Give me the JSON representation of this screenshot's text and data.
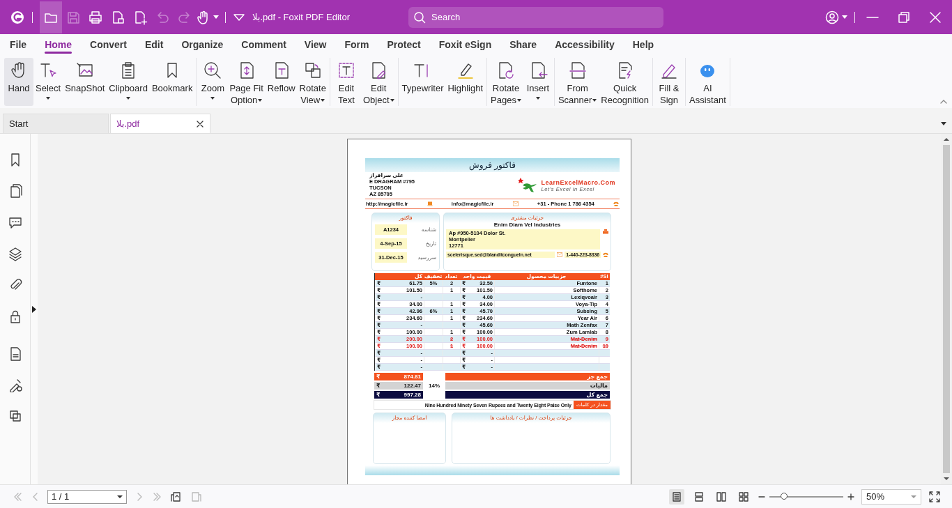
{
  "titlebar": {
    "title": "بلا.pdf - Foxit PDF Editor",
    "search": {
      "placeholder": "Search"
    }
  },
  "quick_access": [
    {
      "highlighted": true,
      "disabled": false
    },
    {
      "highlighted": false,
      "disabled": true
    },
    {
      "highlighted": false,
      "disabled": false
    },
    {
      "highlighted": false,
      "disabled": false
    },
    {
      "highlighted": false,
      "disabled": false
    },
    {
      "highlighted": false,
      "disabled": true
    },
    {
      "highlighted": false,
      "disabled": true
    },
    {
      "highlighted": false,
      "disabled": false
    }
  ],
  "menu": [
    {
      "label": "File",
      "selected": false
    },
    {
      "label": "Home",
      "selected": true
    },
    {
      "label": "Convert",
      "selected": false
    },
    {
      "label": "Edit",
      "selected": false
    },
    {
      "label": "Organize",
      "selected": false
    },
    {
      "label": "Comment",
      "selected": false
    },
    {
      "label": "View",
      "selected": false
    },
    {
      "label": "Form",
      "selected": false
    },
    {
      "label": "Protect",
      "selected": false
    },
    {
      "label": "Foxit eSign",
      "selected": false
    },
    {
      "label": "Share",
      "selected": false
    },
    {
      "label": "Accessibility",
      "selected": false
    },
    {
      "label": "Help",
      "selected": false
    }
  ],
  "ribbon": [
    [
      {
        "label": "Hand",
        "dropdown": false,
        "selected": true
      },
      {
        "label": "Select",
        "dropdown": true,
        "selected": false
      },
      {
        "label": "SnapShot",
        "dropdown": false,
        "selected": false
      },
      {
        "label": "Clipboard",
        "dropdown": true,
        "selected": false
      },
      {
        "label": "Bookmark",
        "dropdown": false,
        "selected": false
      }
    ],
    [
      {
        "label": "Zoom",
        "dropdown": true,
        "selected": false
      },
      {
        "label": "Page Fit\nOption",
        "dropdown": true,
        "selected": false
      },
      {
        "label": "Reflow",
        "dropdown": false,
        "selected": false
      },
      {
        "label": "Rotate\nView",
        "dropdown": true,
        "selected": false
      }
    ],
    [
      {
        "label": "Edit\nText",
        "dropdown": false,
        "selected": false
      },
      {
        "label": "Edit\nObject",
        "dropdown": true,
        "selected": false
      }
    ],
    [
      {
        "label": "Typewriter",
        "dropdown": false,
        "selected": false
      },
      {
        "label": "Highlight",
        "dropdown": false,
        "selected": false
      }
    ],
    [
      {
        "label": "Rotate\nPages",
        "dropdown": true,
        "selected": false
      },
      {
        "label": "Insert",
        "dropdown": true,
        "selected": false
      }
    ],
    [
      {
        "label": "From\nScanner",
        "dropdown": true,
        "selected": false
      },
      {
        "label": "Quick\nRecognition",
        "dropdown": false,
        "selected": false
      }
    ],
    [
      {
        "label": "Fill &\nSign",
        "dropdown": false,
        "selected": false
      }
    ],
    [
      {
        "label": "AI\nAssistant",
        "dropdown": false,
        "selected": false
      }
    ]
  ],
  "doc_tabs": [
    {
      "label": "Start",
      "selected": false,
      "closable": false
    },
    {
      "label": "بلا.pdf",
      "selected": true,
      "closable": true
    }
  ],
  "invoice": {
    "title": "فاکتور فروش",
    "seller_lines": [
      "علی سرافراز",
      "E DRAGRAM #795",
      "TUCSON",
      "AZ 85705"
    ],
    "logo": {
      "name": "LearnExcelMacro.Com",
      "tagline": "Let's Excel in Excel"
    },
    "website": "http://magicfile.ir",
    "email": "info@magicfile.ir",
    "phone": "+31 - Phone 1 786 4354",
    "invoice_panel": {
      "title": "فاکتور",
      "fields": [
        {
          "label": "شناسه",
          "value": "A1234"
        },
        {
          "label": "تاریخ",
          "value": "4-Sep-15"
        },
        {
          "label": "سررسید",
          "value": "31-Dec-15"
        }
      ]
    },
    "customer": {
      "title": "جزئیات مشتری",
      "company": "Enim Diam Vel Industries",
      "address": [
        "Ap #950-5104 Dolor St.",
        "Montpelier",
        "12771"
      ],
      "email": "scelerisque.sed@blanditcongueIn.net",
      "phone": "1-440-223-8336"
    },
    "table": {
      "columns": [
        "SI#",
        "جزییات محصول",
        "قیمت واحد",
        "تعداد",
        "تخفیف",
        "کل"
      ],
      "rows": [
        {
          "no": "1",
          "item": "Funtone",
          "price_symbol": "₹",
          "price": "32.50",
          "qty": "2",
          "discount": "5%",
          "total_symbol": "₹",
          "total": "61.75",
          "struck": false
        },
        {
          "no": "2",
          "item": "Softhome",
          "price_symbol": "₹",
          "price": "101.50",
          "qty": "1",
          "total_symbol": "₹",
          "total": "101.50",
          "struck": false
        },
        {
          "no": "3",
          "item": "Lexiqvoair",
          "price_symbol": "₹",
          "price": "4.00",
          "total_symbol": "₹",
          "total": "-",
          "struck": false
        },
        {
          "no": "4",
          "item": "Voya-Tip",
          "price_symbol": "₹",
          "price": "34.00",
          "qty": "1",
          "total_symbol": "₹",
          "total": "34.00",
          "struck": false
        },
        {
          "no": "5",
          "item": "Subsing",
          "price_symbol": "₹",
          "price": "45.70",
          "qty": "1",
          "discount": "6%",
          "total_symbol": "₹",
          "total": "42.96",
          "struck": false
        },
        {
          "no": "6",
          "item": "Year Air",
          "price_symbol": "₹",
          "price": "234.60",
          "qty": "1",
          "total_symbol": "₹",
          "total": "234.60",
          "struck": false
        },
        {
          "no": "7",
          "item": "Math Zenfax",
          "price_symbol": "₹",
          "price": "45.60",
          "total_symbol": "₹",
          "total": "-",
          "struck": false
        },
        {
          "no": "8",
          "item": "Zum Lamlab",
          "price_symbol": "₹",
          "price": "100.00",
          "qty": "1",
          "total_symbol": "₹",
          "total": "100.00",
          "struck": false
        },
        {
          "no": "9",
          "item": "Mat-Denim",
          "price_symbol": "₹",
          "price": "100.00",
          "qty": "2",
          "total_symbol": "₹",
          "total": "200.00",
          "struck": true
        },
        {
          "no": "10",
          "item": "Mat-Denim",
          "price_symbol": "₹",
          "price": "100.00",
          "qty": "1",
          "total_symbol": "₹",
          "total": "100.00",
          "struck": true
        },
        {
          "price_symbol": "₹",
          "price": "-",
          "total_symbol": "₹",
          "total": "-",
          "struck": false
        },
        {
          "price_symbol": "₹",
          "price": "-",
          "total_symbol": "₹",
          "total": "-",
          "struck": false
        },
        {
          "price_symbol": "₹",
          "price": "-",
          "total_symbol": "₹",
          "total": "-",
          "struck": false
        }
      ]
    },
    "totals": [
      {
        "kind": "subtotal",
        "symbol": "₹",
        "amount": "874.81",
        "label": "جمع جز"
      },
      {
        "kind": "tax",
        "symbol": "₹",
        "amount": "122.47",
        "rate": "14%",
        "label": "مالیات"
      },
      {
        "kind": "grand",
        "symbol": "₹",
        "amount": "997.28",
        "label": "جمع کل"
      }
    ],
    "amount_words": {
      "label": "مقدار در کلمات",
      "text": "Nine Hundred Ninety Seven Rupees and Twenty Eight Paise Only"
    },
    "signature_title": "امضا کننده مجاز",
    "notes_title": "جزئیات پرداخت / نظرات / یادداشت ها"
  },
  "status_bar": {
    "nav": [
      {
        "disabled": true
      },
      {
        "disabled": true
      },
      {
        "disabled": true
      },
      {
        "disabled": true
      }
    ],
    "page": "1 / 1",
    "view_modes": [
      {
        "selected": true
      },
      {
        "selected": false
      },
      {
        "selected": false
      },
      {
        "selected": false
      }
    ],
    "zoom_slider": {
      "level": 0.2
    },
    "zoom": "50%"
  }
}
